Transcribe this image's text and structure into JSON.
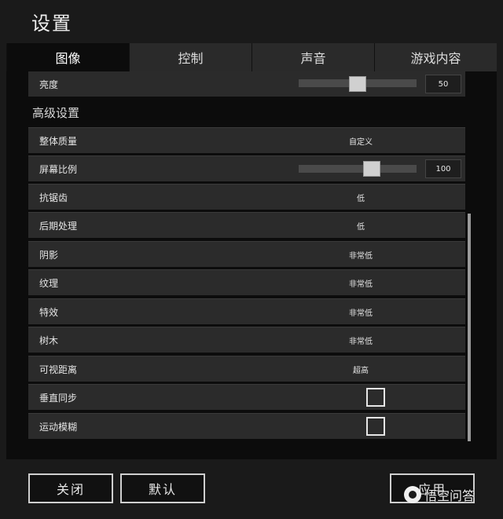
{
  "window": {
    "title": "设置"
  },
  "tabs": [
    {
      "label": "图像",
      "active": true
    },
    {
      "label": "控制",
      "active": false
    },
    {
      "label": "声音",
      "active": false
    },
    {
      "label": "游戏内容",
      "active": false
    }
  ],
  "brightness": {
    "label": "亮度",
    "value": "50",
    "level": 0.5
  },
  "advanced": {
    "section_title": "高级设置",
    "overall_quality": {
      "label": "整体质量",
      "value": "自定义"
    },
    "screen_scale": {
      "label": "屏幕比例",
      "value": "100",
      "level": 0.62
    },
    "anti_aliasing": {
      "label": "抗锯齿",
      "value": "低"
    },
    "post_processing": {
      "label": "后期处理",
      "value": "低"
    },
    "shadows": {
      "label": "阴影",
      "value": "非常低"
    },
    "textures": {
      "label": "纹理",
      "value": "非常低"
    },
    "effects": {
      "label": "特效",
      "value": "非常低"
    },
    "foliage": {
      "label": "树木",
      "value": "非常低"
    },
    "view_distance": {
      "label": "可视距离",
      "value": "超高"
    },
    "vsync": {
      "label": "垂直同步",
      "checked": false
    },
    "motion_blur": {
      "label": "运动模糊",
      "checked": false
    }
  },
  "buttons": {
    "close": "关闭",
    "default": "默认",
    "apply": "应用"
  },
  "watermark": "悟空问答"
}
